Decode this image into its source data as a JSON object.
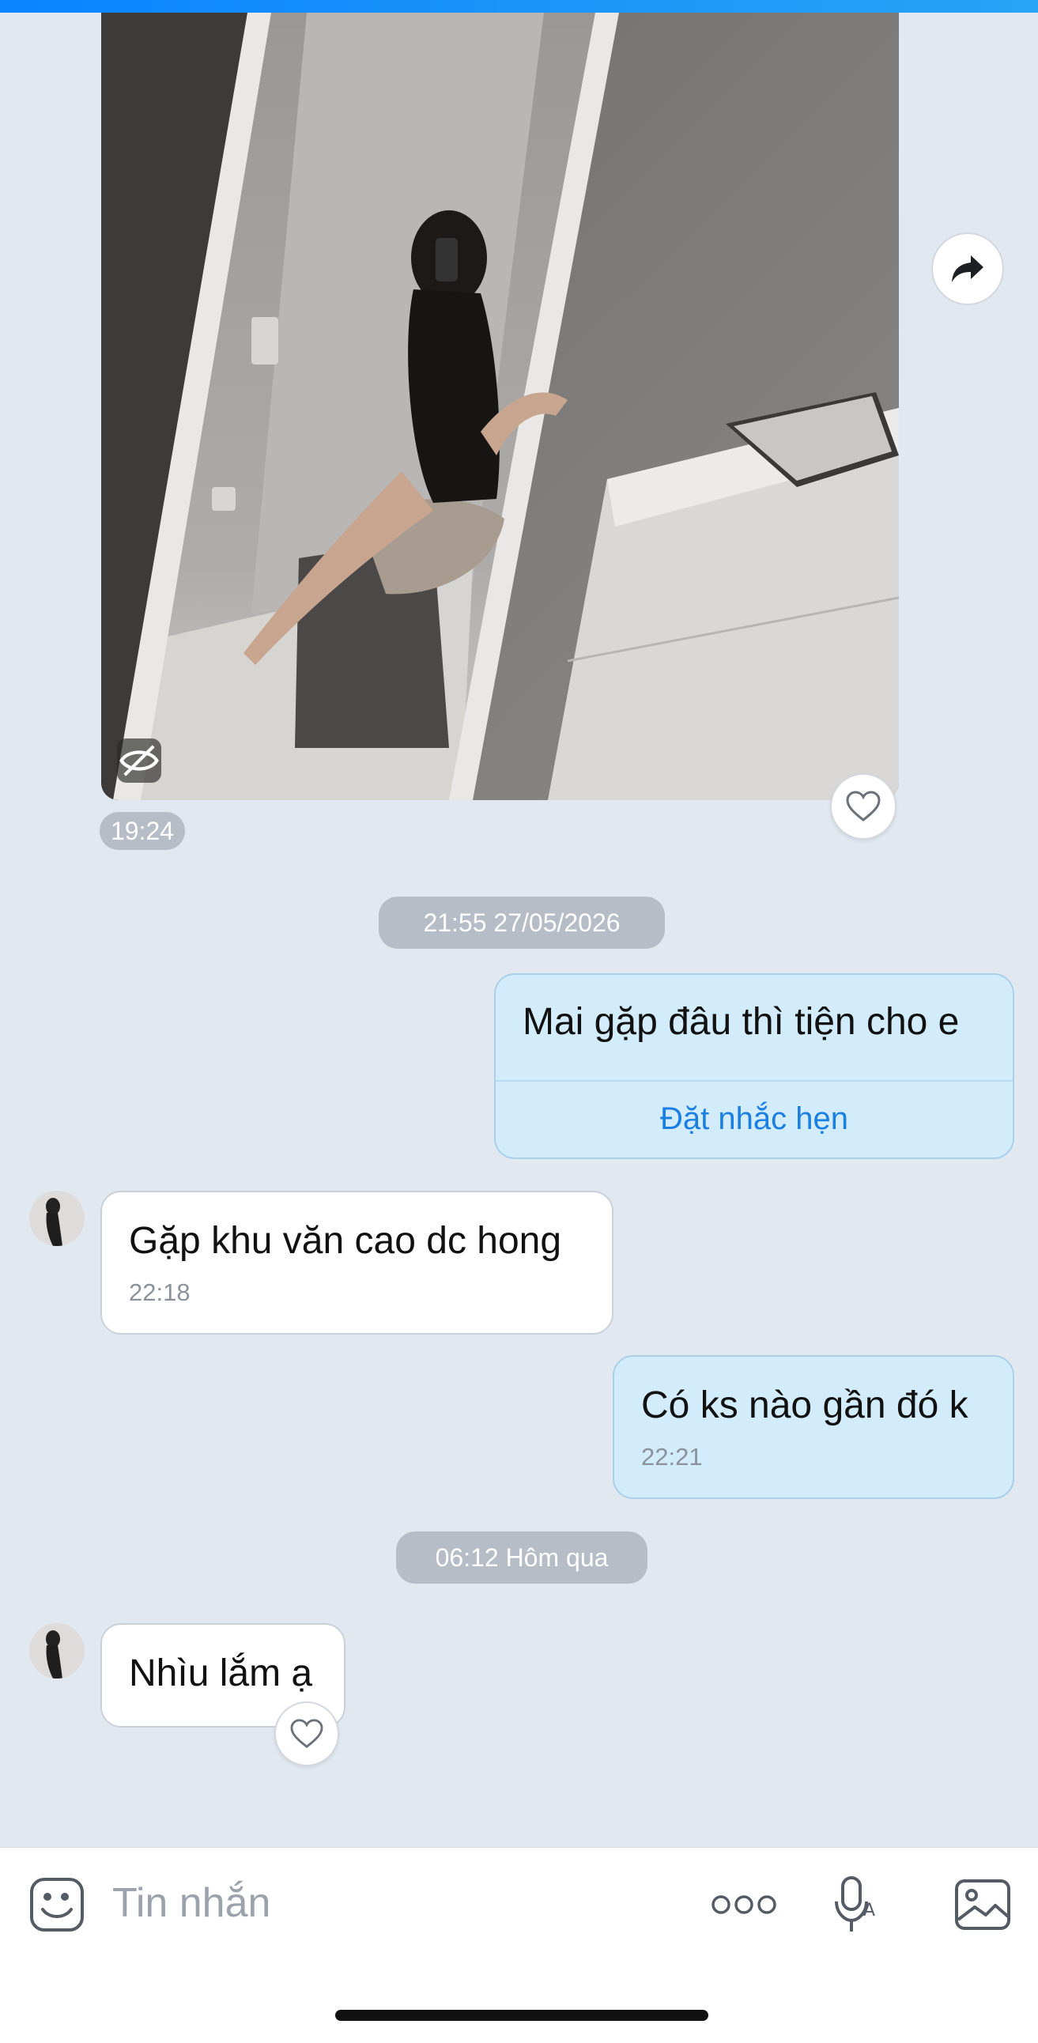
{
  "photo_message": {
    "time": "19:24"
  },
  "date_separators": [
    "21:55 27/05/2026",
    "06:12 Hôm qua"
  ],
  "messages": [
    {
      "sender": "me",
      "text": "Mai gặp đâu thì tiện cho e",
      "action": "Đặt nhắc hẹn"
    },
    {
      "sender": "contact",
      "text": "Gặp khu văn cao dc hong",
      "time": "22:18"
    },
    {
      "sender": "me",
      "text": "Có ks nào gần đó k",
      "time": "22:21"
    },
    {
      "sender": "contact",
      "text": "Nhìu lắm ạ"
    }
  ],
  "composer": {
    "placeholder": "Tin nhắn"
  },
  "icons": {
    "share": "share-arrow-icon",
    "hidden": "eye-slash-icon",
    "like": "heart-icon",
    "sticker": "sticker-icon",
    "more": "more-dots-icon",
    "voice": "mic-icon",
    "gallery": "image-icon"
  },
  "colors": {
    "background": "#e2e8f0",
    "outgoing_bubble": "#d3ecfb",
    "incoming_bubble": "#ffffff",
    "link": "#1a7fe0",
    "accent_bar": "#0a84ff"
  }
}
